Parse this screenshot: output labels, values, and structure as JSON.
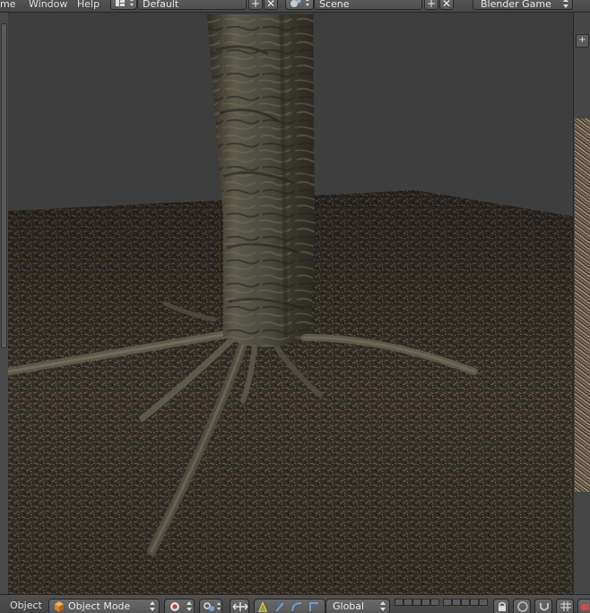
{
  "topbar": {
    "menus": [
      "me",
      "Window",
      "Help"
    ],
    "screen_layout": "Default",
    "scene": "Scene",
    "render_engine": "Blender Game",
    "add_symbol": "+",
    "close_symbol": "✕"
  },
  "viewport_header": {
    "object_menu": "Object",
    "mode": "Object Mode",
    "orientation": "Global"
  },
  "colors": {
    "background": "#3e3e3e",
    "header": "#4a4a4a",
    "ground": "#3a332b",
    "bark": "#4f4c3f"
  }
}
